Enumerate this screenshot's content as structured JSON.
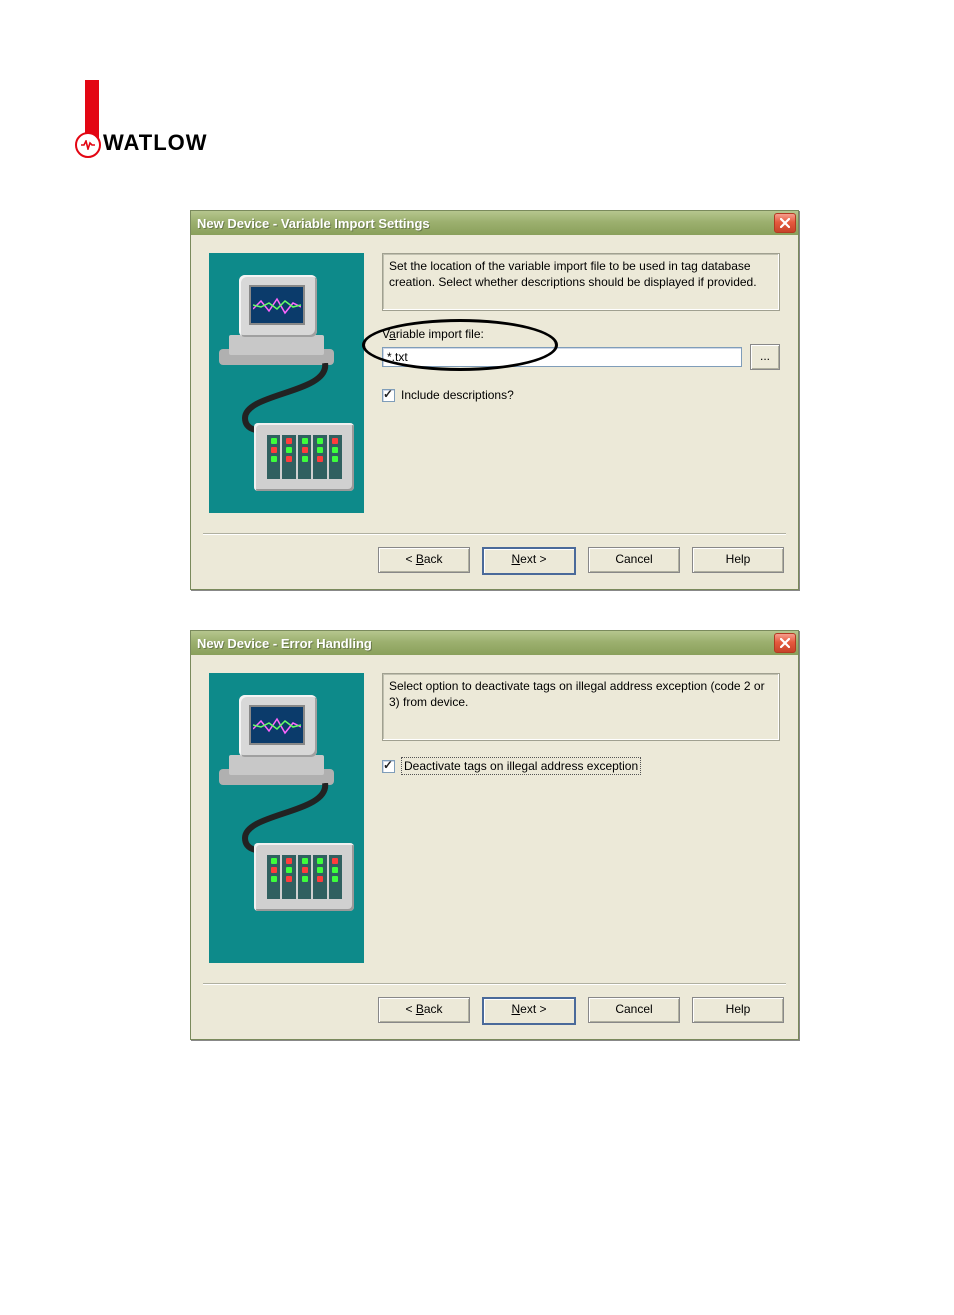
{
  "logo": {
    "text": "WATLOW"
  },
  "dialog1": {
    "title": "New Device - Variable Import Settings",
    "instructions": "Set the location of the variable import file to be used in tag database creation.  Select whether descriptions should be displayed if provided.",
    "field_label_pre": "V",
    "field_label_u": "a",
    "field_label_post": "riable import file:",
    "file_value": "*.txt",
    "browse_label": "...",
    "chk_pre": "Include ",
    "chk_u": "d",
    "chk_post": "escriptions?",
    "buttons": {
      "back_pre": "< ",
      "back_u": "B",
      "back_post": "ack",
      "next_u": "N",
      "next_post": "ext >",
      "cancel": "Cancel",
      "help": "Help"
    }
  },
  "dialog2": {
    "title": "New Device - Error Handling",
    "instructions": "Select option to deactivate tags on illegal address exception (code 2 or 3) from device.",
    "chk_u": "D",
    "chk_post": "eactivate tags on illegal address exception",
    "buttons": {
      "back_pre": "< ",
      "back_u": "B",
      "back_post": "ack",
      "next_u": "N",
      "next_post": "ext >",
      "cancel": "Cancel",
      "help": "Help"
    }
  }
}
